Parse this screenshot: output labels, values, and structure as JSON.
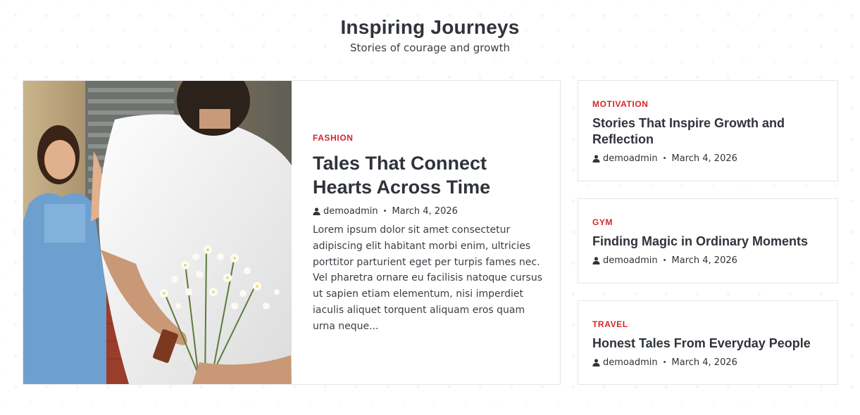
{
  "header": {
    "title": "Inspiring Journeys",
    "subtitle": "Stories of courage and growth"
  },
  "featured": {
    "category": "FASHION",
    "title": "Tales That Connect Hearts Across Time",
    "author": "demoadmin",
    "separator": "•",
    "date": "March 4, 2026",
    "excerpt": "Lorem ipsum dolor sit amet consectetur adipiscing elit habitant morbi enim, ultricies porttitor parturient eget per turpis fames nec. Vel pharetra ornare eu facilisis natoque cursus ut sapien etiam elementum, nisi imperdiet iaculis aliquet torquent aliquam eros quam urna neque..."
  },
  "posts": [
    {
      "category": "MOTIVATION",
      "title": "Stories That Inspire Growth and Reflection",
      "author": "demoadmin",
      "separator": "•",
      "date": "March 4, 2026"
    },
    {
      "category": "GYM",
      "title": "Finding Magic in Ordinary Moments",
      "author": "demoadmin",
      "separator": "•",
      "date": "March 4, 2026"
    },
    {
      "category": "TRAVEL",
      "title": "Honest Tales From Everyday People",
      "author": "demoadmin",
      "separator": "•",
      "date": "March 4, 2026"
    }
  ],
  "icons": {
    "author": "user-icon"
  },
  "colors": {
    "accent": "#d6262b",
    "text": "#2f333a",
    "border": "#e6e6e6"
  }
}
